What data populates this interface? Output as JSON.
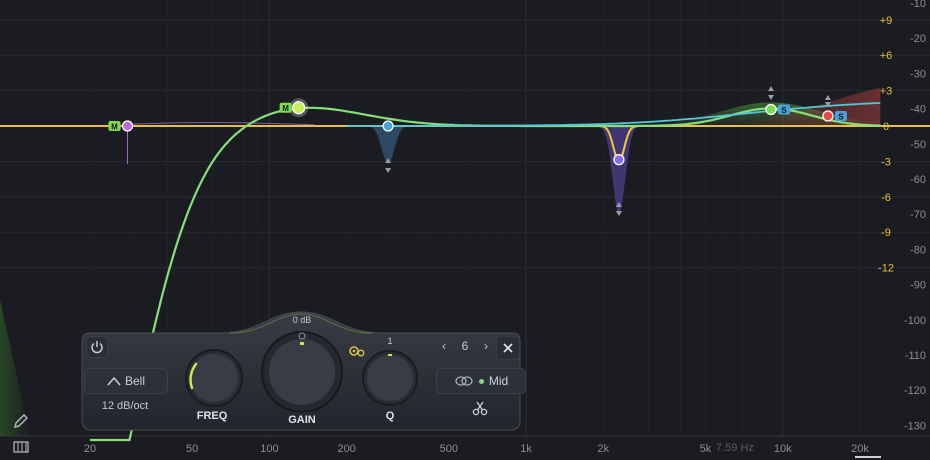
{
  "colors": {
    "background": "#1b1c21",
    "grid": "#2a2c33",
    "zero_line": "#e8c23a",
    "band1": "#c26bd8",
    "band2": "#c9f05b",
    "band3": "#4aa0d8",
    "band4": "#8a6bea",
    "band5": "#7ddc4f",
    "band6": "#e84a4a",
    "curve_mid": "#86e07a",
    "curve_side": "#54c6d6",
    "curve_yellow": "#f2c640"
  },
  "freq_axis": {
    "labels": [
      "20",
      "50",
      "100",
      "200",
      "500",
      "1k",
      "2k",
      "5k",
      "10k",
      "20k"
    ],
    "values": [
      20,
      50,
      100,
      200,
      500,
      1000,
      2000,
      5000,
      10000,
      20000
    ],
    "cursor_readout": "7.59 Hz"
  },
  "gain_axis": {
    "labels": [
      "+9",
      "+6",
      "+3",
      "0",
      "-3",
      "-6",
      "-9",
      "-12"
    ],
    "values": [
      9,
      6,
      3,
      0,
      -3,
      -6,
      -9,
      -12
    ]
  },
  "spectrum_axis": {
    "labels": [
      "-10",
      "-20",
      "-30",
      "-40",
      "-50",
      "-60",
      "-70",
      "-80",
      "-90",
      "-100",
      "-110",
      "-120",
      "-130"
    ],
    "values": [
      -10,
      -20,
      -30,
      -40,
      -50,
      -60,
      -70,
      -80,
      -90,
      -100,
      -110,
      -120,
      -130
    ]
  },
  "bands": [
    {
      "id": 1,
      "badge": "M",
      "freq": 28,
      "gain": 0,
      "type": "high-cut",
      "color": "#c26bd8"
    },
    {
      "id": 2,
      "badge": "M",
      "freq": 130,
      "gain": 2.5,
      "type": "bell",
      "color": "#c9f05b",
      "selected": true
    },
    {
      "id": 3,
      "badge": "",
      "freq": 290,
      "gain": 0,
      "type": "notch",
      "color": "#4aa0d8"
    },
    {
      "id": 4,
      "badge": "",
      "freq": 2300,
      "gain": -5,
      "type": "notch",
      "color": "#8a6bea"
    },
    {
      "id": 5,
      "badge": "S",
      "freq": 9000,
      "gain": 2,
      "type": "bell",
      "color": "#7ddc4f"
    },
    {
      "id": 6,
      "badge": "S",
      "freq": 15000,
      "gain": 1.5,
      "type": "shelf",
      "color": "#e84a4a"
    }
  ],
  "panel": {
    "shape_label": "Bell",
    "slope_label": "12 dB/oct",
    "freq_label": "FREQ",
    "gain_label": "GAIN",
    "gain_value": "0 dB",
    "q_label": "Q",
    "q_value": "1",
    "band_number": "6",
    "nav_prev": "‹",
    "nav_next": "›",
    "stereo_label": "Mid",
    "freq_knob_fraction": 0.35,
    "gain_knob_fraction": 0.5,
    "q_knob_fraction": 0.5
  },
  "icons": {
    "power": "power-icon",
    "close": "close-icon",
    "bell": "bell-shape-icon",
    "stereo": "stereo-link-icon",
    "scissors": "scissors-icon",
    "edit": "pencil-icon",
    "piano": "piano-icon",
    "gain_scale": "gain-scale-icon",
    "settings": "gear-icon"
  }
}
